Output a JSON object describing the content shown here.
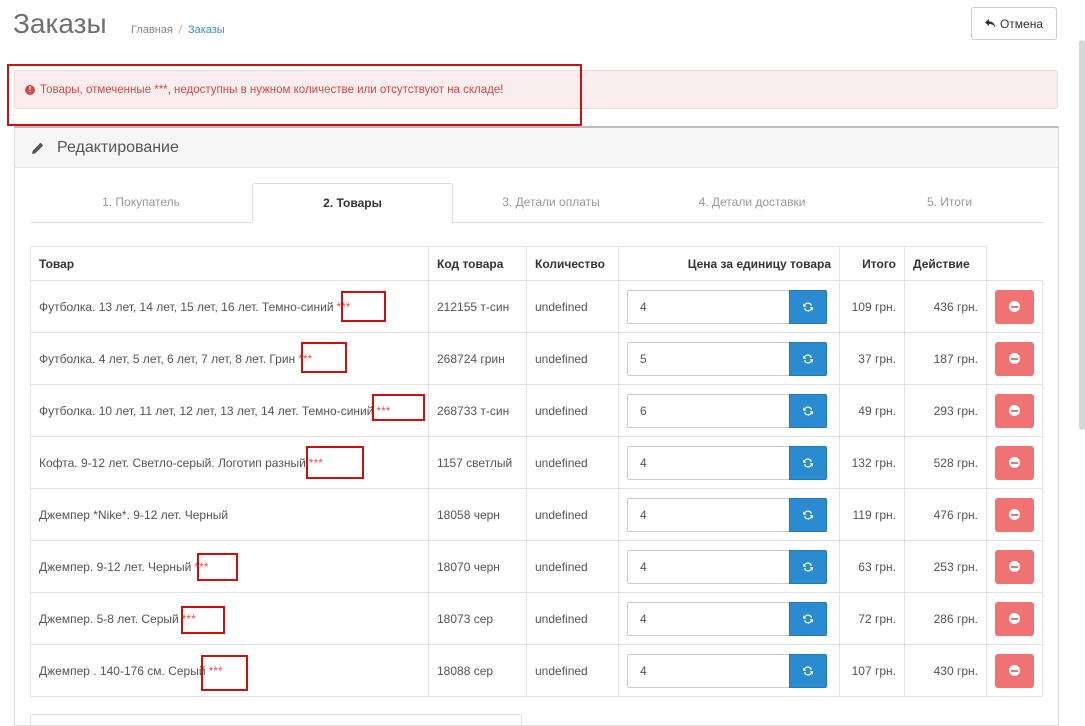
{
  "page": {
    "title": "Заказы",
    "cancel_label": "Отмена"
  },
  "breadcrumb": {
    "home": "Главная",
    "separator": "/",
    "current": "Заказы"
  },
  "alert": {
    "text": "Товары, отмеченные ***, недоступны в нужном количестве или отсутствуют на складе!"
  },
  "panel": {
    "title": "Редактирование"
  },
  "tabs": [
    {
      "label": "1. Покупатель"
    },
    {
      "label": "2. Товары"
    },
    {
      "label": "3. Детали оплаты"
    },
    {
      "label": "4. Детали доставки"
    },
    {
      "label": "5. Итоги"
    }
  ],
  "table": {
    "headers": {
      "product": "Товар",
      "code": "Код товара",
      "quantity": "Количество",
      "unit_price": "Цена за единицу товара",
      "total": "Итого",
      "action": "Действие"
    },
    "rows": [
      {
        "name": "Футболка. 13 лет, 14 лет, 15 лет, 16 лет. Темно-синий",
        "stars": "***",
        "code": "212155 т-син",
        "quantity": "undefined",
        "qty_input": "4",
        "price": "109 грн.",
        "total": "436 грн."
      },
      {
        "name": "Футболка. 4 лет, 5 лет, 6 лет, 7 лет, 8 лет. Грин",
        "stars": "***",
        "code": "268724 грин",
        "quantity": "undefined",
        "qty_input": "5",
        "price": "37 грн.",
        "total": "187 грн."
      },
      {
        "name": "Футболка. 10 лет, 11 лет, 12 лет, 13 лет, 14 лет. Темно-синий",
        "stars": "***",
        "code": "268733 т-син",
        "quantity": "undefined",
        "qty_input": "6",
        "price": "49 грн.",
        "total": "293 грн."
      },
      {
        "name": "Кофта. 9-12 лет. Светло-серый. Логотип разный",
        "stars": "***",
        "code": "1157 светлый",
        "quantity": "undefined",
        "qty_input": "4",
        "price": "132 грн.",
        "total": "528 грн."
      },
      {
        "name": "Джемпер *Nike*. 9-12 лет. Черный",
        "stars": "",
        "code": "18058 черн",
        "quantity": "undefined",
        "qty_input": "4",
        "price": "119 грн.",
        "total": "476 грн."
      },
      {
        "name": "Джемпер. 9-12 лет. Черный",
        "stars": "***",
        "code": "18070 черн",
        "quantity": "undefined",
        "qty_input": "4",
        "price": "63 грн.",
        "total": "253 грн."
      },
      {
        "name": "Джемпер. 5-8 лет. Серый",
        "stars": "***",
        "code": "18073 сер",
        "quantity": "undefined",
        "qty_input": "4",
        "price": "72 грн.",
        "total": "286 грн."
      },
      {
        "name": "Джемпер . 140-176 см. Серый",
        "stars": "***",
        "code": "18088 сер",
        "quantity": "undefined",
        "qty_input": "4",
        "price": "107 грн.",
        "total": "430 грн."
      }
    ]
  },
  "colors": {
    "alert_text": "#d24a4a",
    "accent_blue": "#2a8bd0",
    "remove_red": "#f07373",
    "annotation_red": "#cc1010"
  },
  "icons": {
    "cancel": "reply-arrow-icon",
    "alert": "exclamation-circle-icon",
    "edit": "pencil-icon",
    "refresh": "refresh-icon",
    "remove": "minus-circle-icon"
  }
}
